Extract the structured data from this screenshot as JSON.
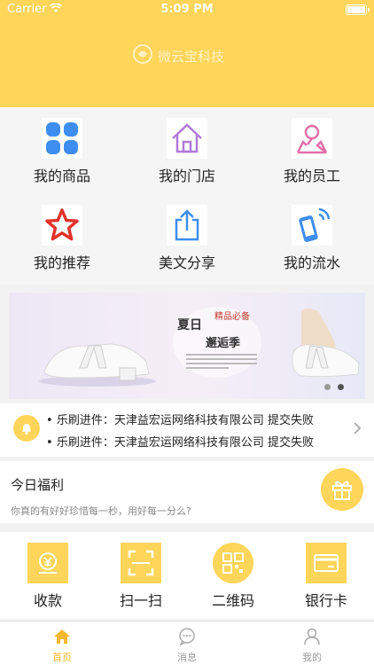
{
  "status_bar": {
    "carrier": "Carrier",
    "time": "5:09 PM"
  },
  "header": {
    "brand": "微云宝科技"
  },
  "grid": [
    {
      "label": "我的商品",
      "icon": "grid-icon"
    },
    {
      "label": "我的门店",
      "icon": "home-icon"
    },
    {
      "label": "我的员工",
      "icon": "person-pin-icon"
    },
    {
      "label": "我的推荐",
      "icon": "star-icon"
    },
    {
      "label": "美文分享",
      "icon": "share-icon"
    },
    {
      "label": "我的流水",
      "icon": "phone-signal-icon"
    }
  ],
  "banner": {
    "title": "夏日",
    "subtitle": "邂逅季",
    "tag": "精品必备",
    "slides": 2,
    "active_slide": 1
  },
  "news": [
    "乐刷进件：天津益宏运网络科技有限公司 提交失败",
    "乐刷进件：天津益宏运网络科技有限公司 提交失败"
  ],
  "welfare": {
    "title": "今日福利",
    "subtitle": "你真的有好好珍惜每一秒，用好每一分么?"
  },
  "quick_actions": [
    {
      "label": "收款",
      "icon": "yuan-icon"
    },
    {
      "label": "扫一扫",
      "icon": "scan-icon"
    },
    {
      "label": "二维码",
      "icon": "qrcode-icon"
    },
    {
      "label": "银行卡",
      "icon": "bank-card-icon"
    }
  ],
  "tabs": [
    {
      "label": "首页",
      "icon": "home-tab-icon",
      "active": true
    },
    {
      "label": "消息",
      "icon": "message-icon",
      "active": false
    },
    {
      "label": "我的",
      "icon": "user-icon",
      "active": false
    }
  ],
  "colors": {
    "accent": "#ffd55a",
    "active_tab": "#f4b82a",
    "blue": "#3d8ef0",
    "purple": "#b07ad8",
    "pink": "#e36fa7",
    "red": "#e2322c"
  }
}
